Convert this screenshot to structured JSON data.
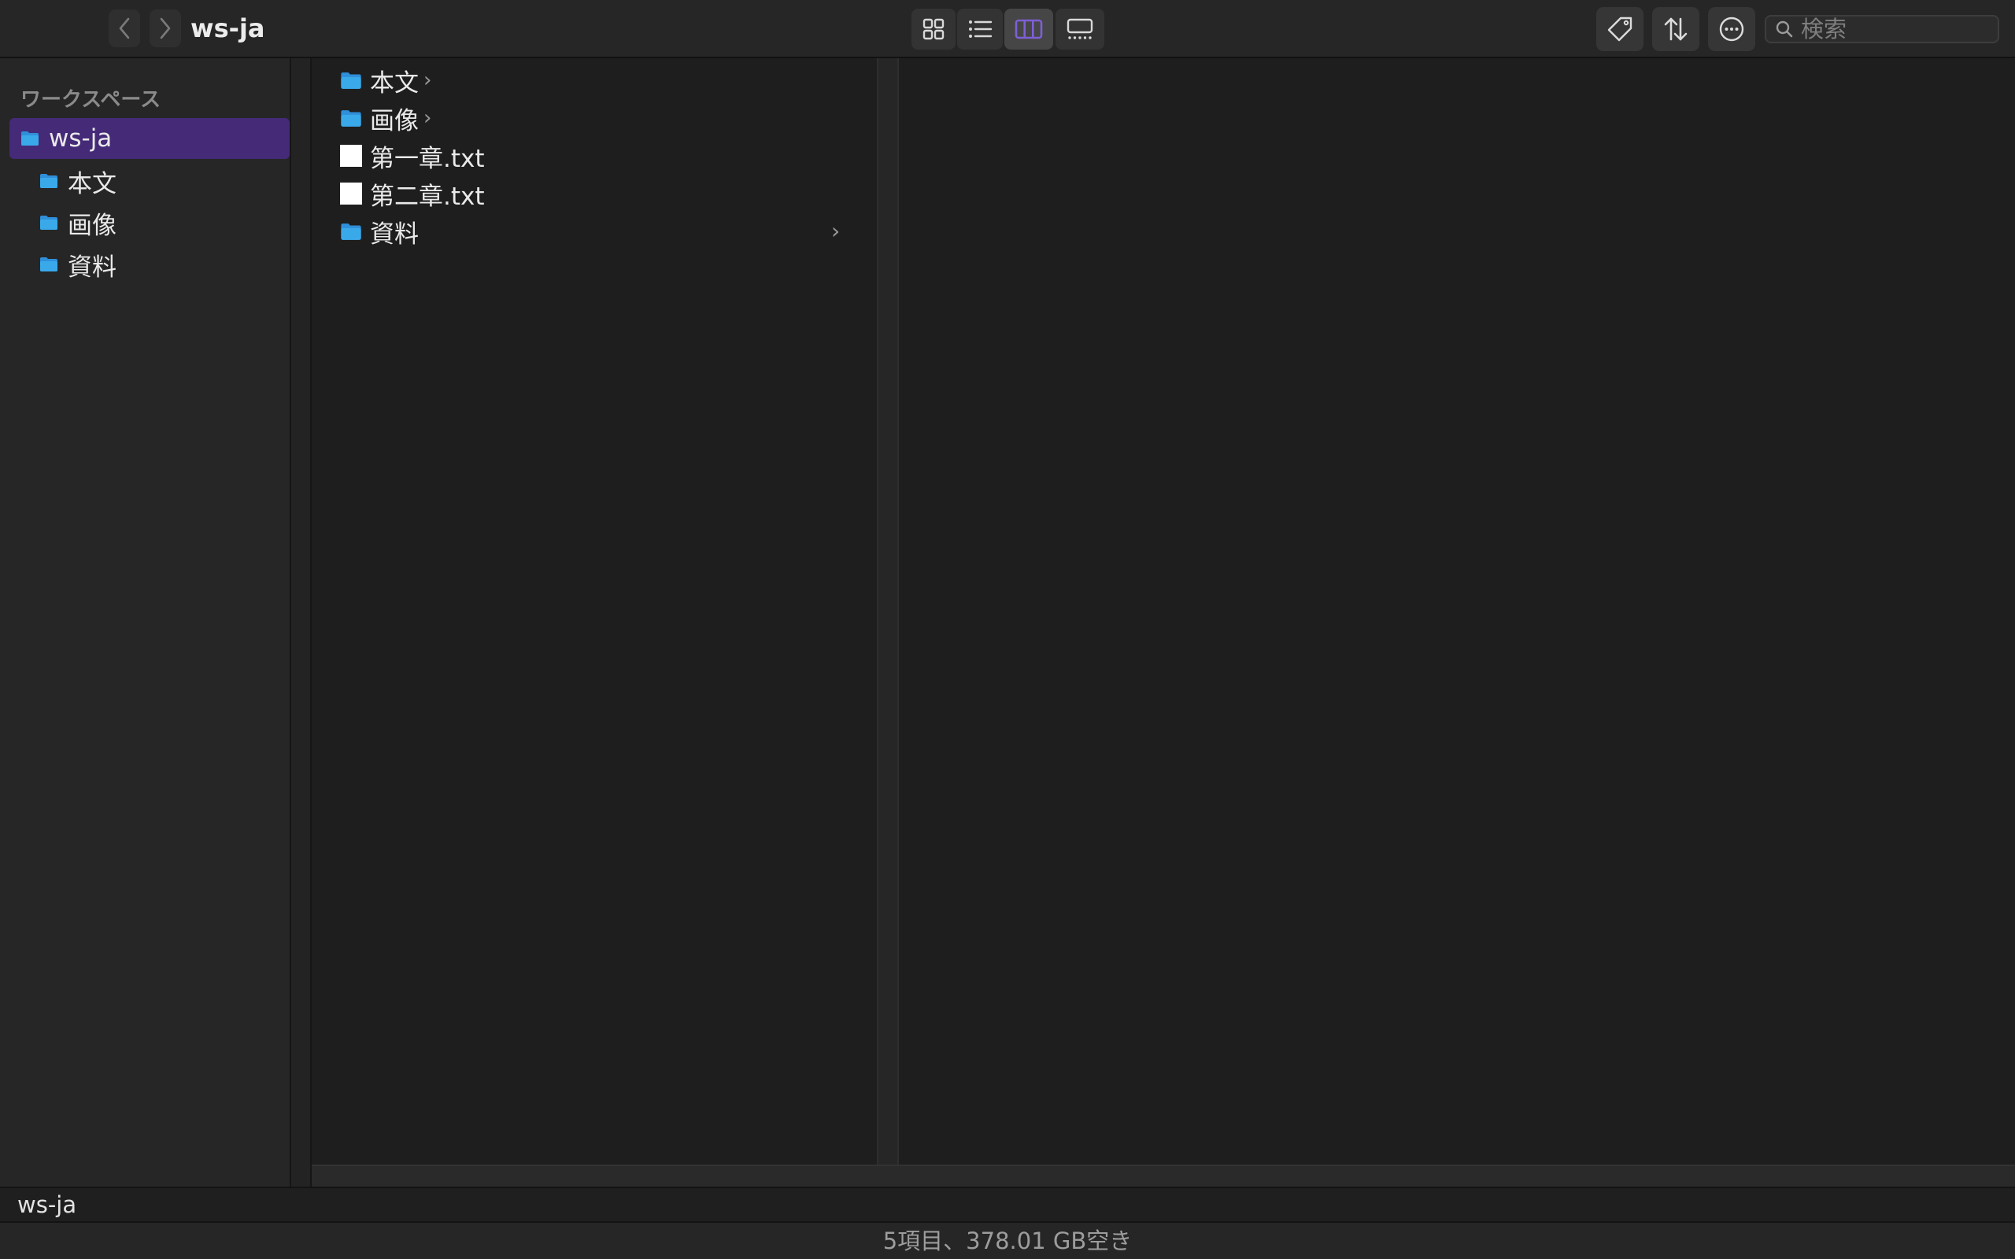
{
  "window": {
    "title": "ws-ja"
  },
  "toolbar": {
    "back_icon": "chevron-left-icon",
    "forward_icon": "chevron-right-icon",
    "views": [
      {
        "name": "icon-view",
        "icon": "grid-icon",
        "active": false
      },
      {
        "name": "list-view",
        "icon": "list-icon",
        "active": false
      },
      {
        "name": "column-view",
        "icon": "columns-icon",
        "active": true
      },
      {
        "name": "gallery-view",
        "icon": "gallery-icon",
        "active": false
      }
    ],
    "tag_icon": "tag-icon",
    "sort_icon": "sort-arrows-icon",
    "more_icon": "ellipsis-circle-icon",
    "search": {
      "placeholder": "検索",
      "value": ""
    }
  },
  "sidebar": {
    "section_title": "ワークスペース",
    "items": [
      {
        "label": "ws-ja",
        "selected": true,
        "indent": 0
      },
      {
        "label": "本文",
        "selected": false,
        "indent": 1
      },
      {
        "label": "画像",
        "selected": false,
        "indent": 1
      },
      {
        "label": "資料",
        "selected": false,
        "indent": 1
      }
    ]
  },
  "column1": {
    "rows": [
      {
        "label": "本文",
        "kind": "folder"
      },
      {
        "label": "画像",
        "kind": "folder"
      },
      {
        "label": "第一章.txt",
        "kind": "file"
      },
      {
        "label": "第二章.txt",
        "kind": "file"
      },
      {
        "label": "資料",
        "kind": "folder"
      }
    ]
  },
  "path_bar": {
    "crumbs": [
      "ws-ja"
    ]
  },
  "status_bar": {
    "text": "5項目、378.01 GB空き"
  },
  "colors": {
    "accent": "#452a78",
    "active_view_icon": "#7d5fd6",
    "folder_blue": "#3aa9ea"
  }
}
